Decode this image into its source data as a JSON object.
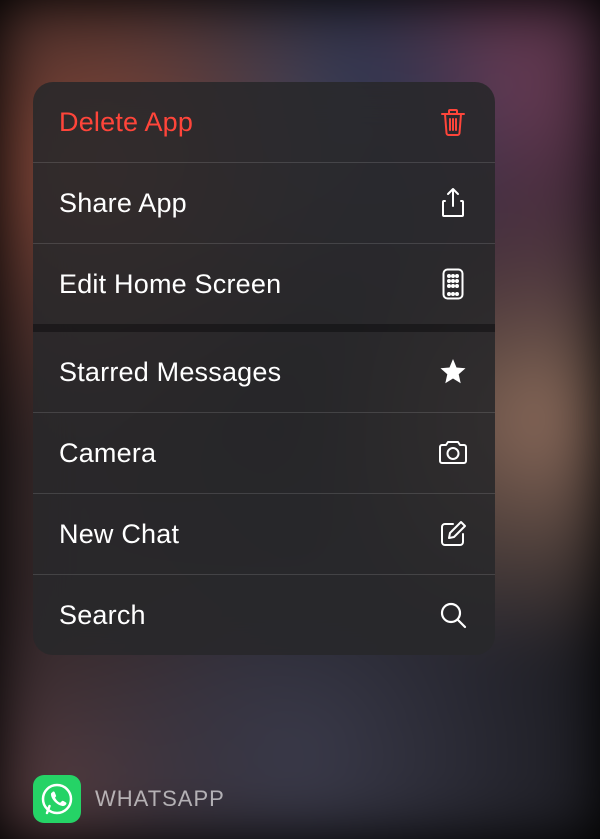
{
  "menu": {
    "group1": [
      {
        "label": "Delete App",
        "icon": "trash-icon",
        "destructive": true
      },
      {
        "label": "Share App",
        "icon": "share-icon",
        "destructive": false
      },
      {
        "label": "Edit Home Screen",
        "icon": "apps-grid-icon",
        "destructive": false
      }
    ],
    "group2": [
      {
        "label": "Starred Messages",
        "icon": "star-icon",
        "destructive": false
      },
      {
        "label": "Camera",
        "icon": "camera-icon",
        "destructive": false
      },
      {
        "label": "New Chat",
        "icon": "compose-icon",
        "destructive": false
      },
      {
        "label": "Search",
        "icon": "search-icon",
        "destructive": false
      }
    ]
  },
  "app": {
    "name": "WHATSAPP"
  }
}
